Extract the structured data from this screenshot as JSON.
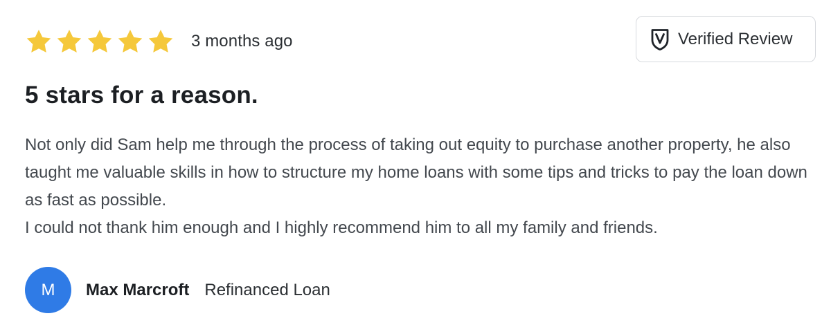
{
  "review": {
    "rating": 5,
    "rating_max": 5,
    "star_color": "#f5c83b",
    "date": "3 months ago",
    "verified_label": "Verified Review",
    "verified_icon": "shield-check-icon",
    "title": "5 stars for a reason.",
    "body_paragraphs": [
      "Not only did Sam help me through the process of taking out equity to purchase another property, he also taught me valuable skills in how to structure my home loans with some tips and tricks to pay the loan down as fast as possible.",
      "I could not thank him enough and I highly recommend him to all my family and friends."
    ]
  },
  "author": {
    "initial": "M",
    "avatar_color": "#2f7be6",
    "name": "Max Marcroft",
    "loan_type": "Refinanced Loan"
  }
}
